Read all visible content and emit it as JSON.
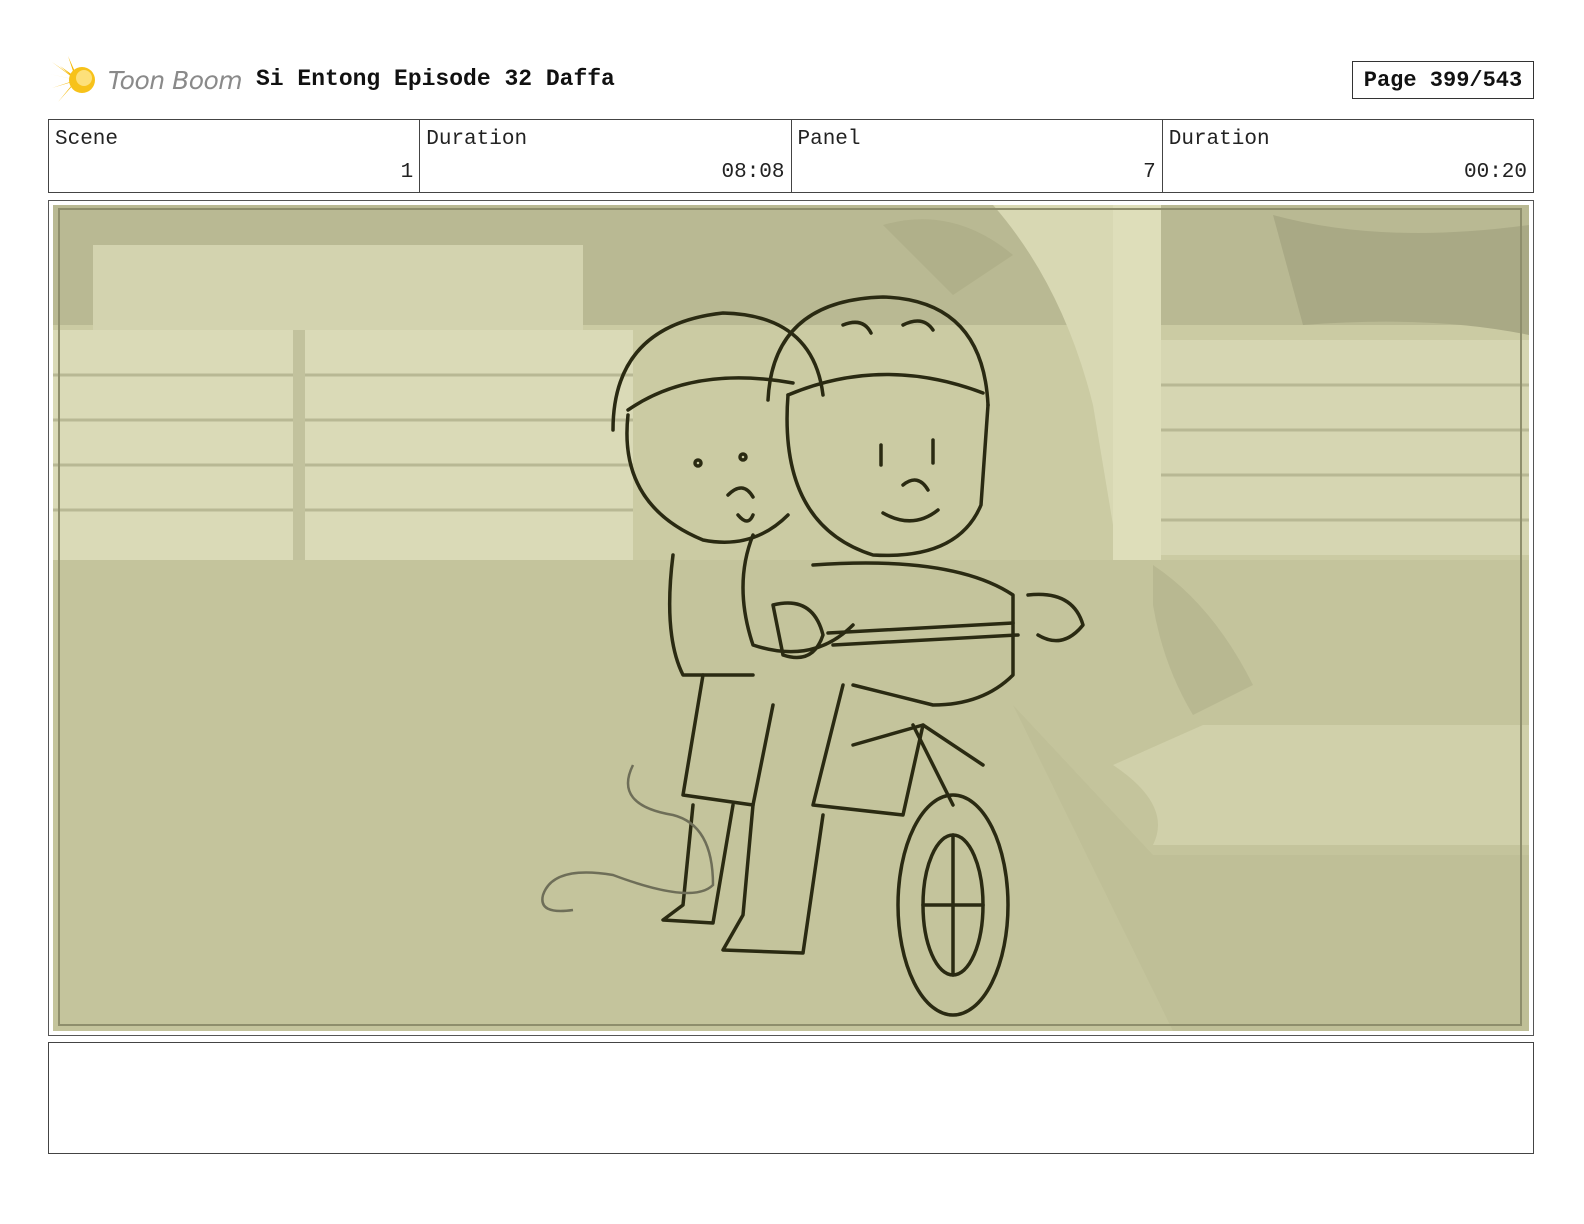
{
  "header": {
    "logo_text": "Toon Boom",
    "title": "Si Entong Episode 32 Daffa",
    "page_label": "Page 399/543"
  },
  "info": {
    "scene_label": "Scene",
    "scene_value": "1",
    "scene_duration_label": "Duration",
    "scene_duration_value": "08:08",
    "panel_label": "Panel",
    "panel_value": "7",
    "panel_duration_label": "Duration",
    "panel_duration_value": "00:20"
  },
  "panel": {
    "image_icon": "storyboard-sketch-two-kids-on-bicycle",
    "colors": {
      "background_tint": "#cfcfa6",
      "sketch_line": "#2a2a12"
    }
  },
  "caption": {
    "text": ""
  }
}
